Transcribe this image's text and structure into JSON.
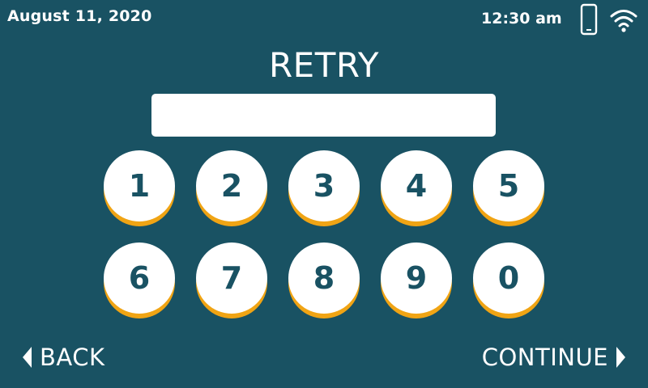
{
  "status": {
    "date": "August 11, 2020",
    "time": "12:30 am",
    "icons": [
      "phone-icon",
      "wifi-icon"
    ]
  },
  "title": "RETRY",
  "code_input": {
    "value": "",
    "placeholder": ""
  },
  "keypad": {
    "row1": [
      "1",
      "2",
      "3",
      "4",
      "5"
    ],
    "row2": [
      "6",
      "7",
      "8",
      "9",
      "0"
    ]
  },
  "nav": {
    "back": "BACK",
    "continue": "CONTINUE"
  },
  "colors": {
    "background": "#195263",
    "key_face": "#ffffff",
    "key_shadow": "#f0a414",
    "key_text": "#195263"
  }
}
